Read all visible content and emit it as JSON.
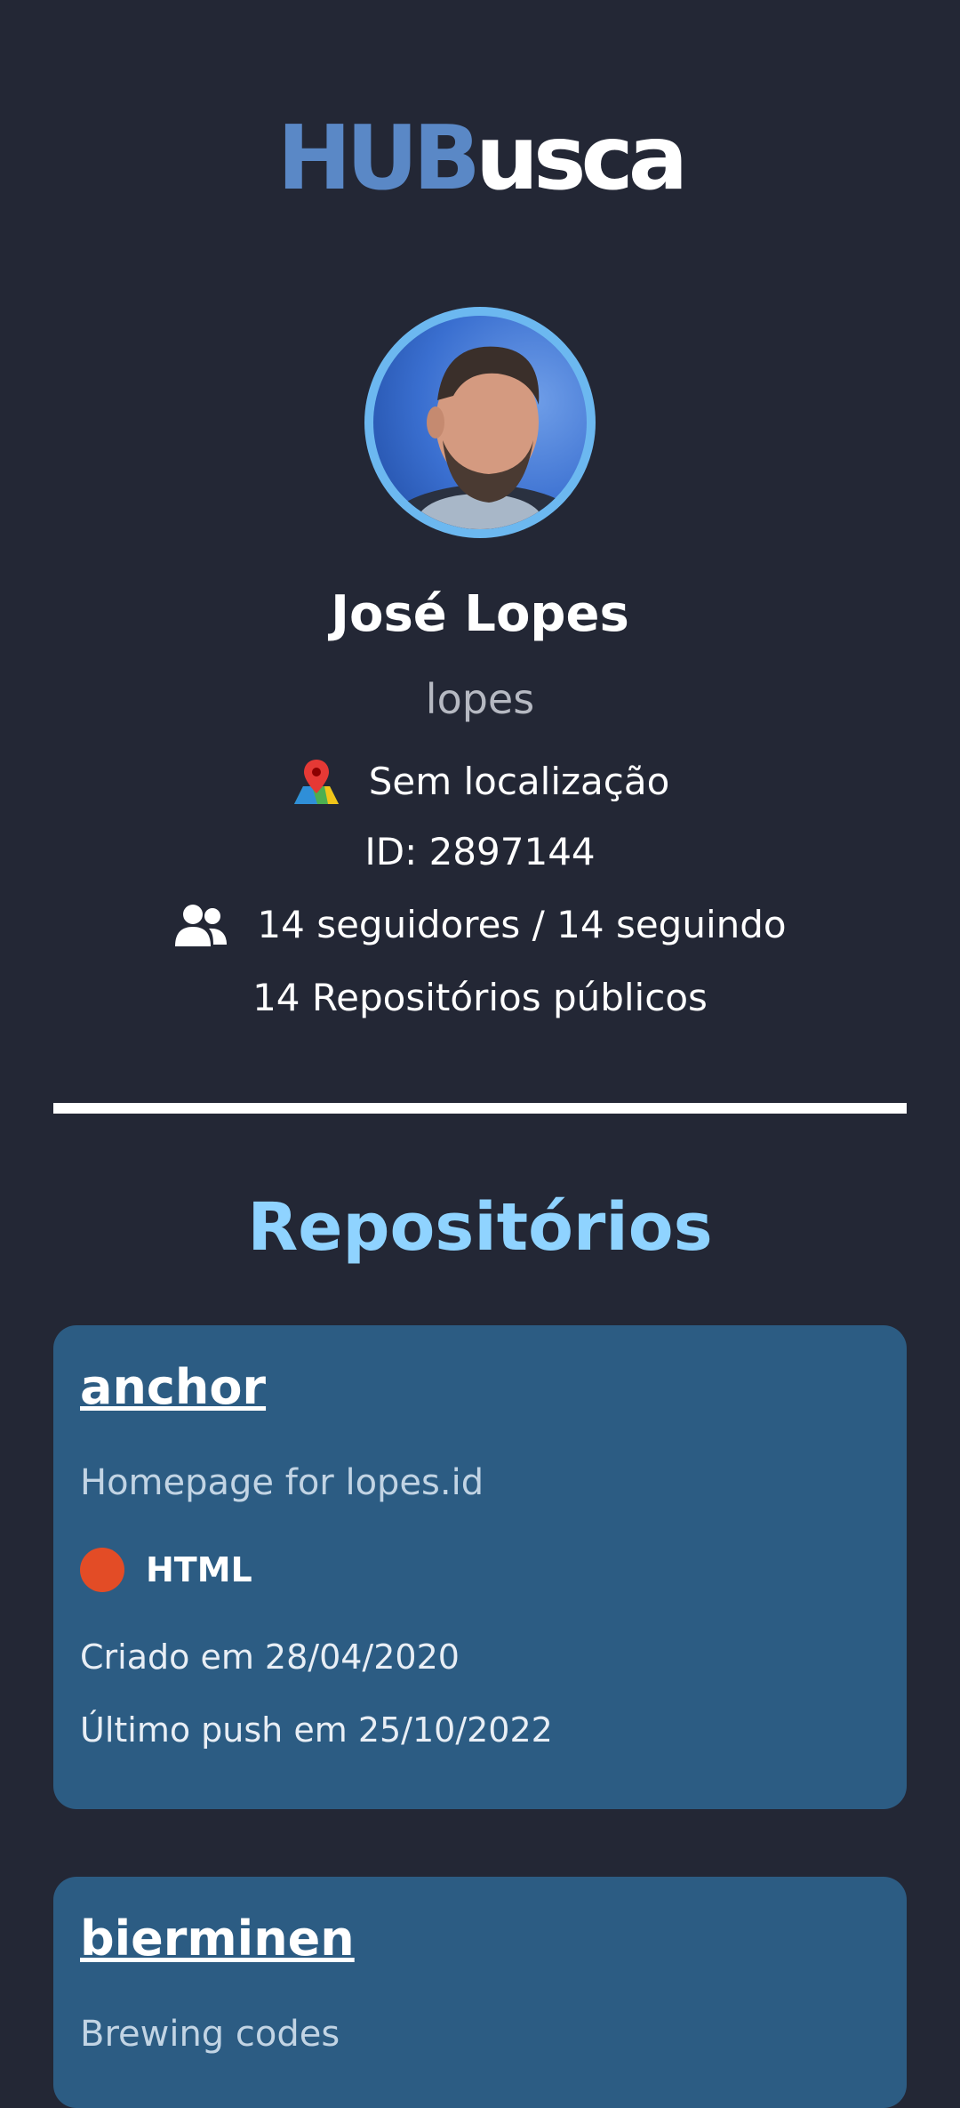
{
  "app": {
    "logo_part1": "HUB",
    "logo_part2": "usca",
    "brand_color": "#5a88c6",
    "background": "#232735"
  },
  "profile": {
    "avatar_icon": "user-avatar",
    "name": "José Lopes",
    "login": "lopes",
    "location_icon": "map-pin-icon",
    "location": "Sem localização",
    "id_text": "ID: 2897144",
    "people_icon": "people-icon",
    "followers_text": "14 seguidores / 14 seguindo",
    "public_repos_text": "14 Repositórios públicos"
  },
  "repos_section": {
    "title": "Repositórios",
    "title_color": "#8fd3ff",
    "card_color": "#2c5c83",
    "items": [
      {
        "name": "anchor",
        "description": "Homepage for lopes.id",
        "language": "HTML",
        "language_color": "#e34c26",
        "created": "Criado em 28/04/2020",
        "pushed": "Último push em 25/10/2022"
      },
      {
        "name": "bierminen",
        "description": "Brewing codes"
      }
    ]
  }
}
